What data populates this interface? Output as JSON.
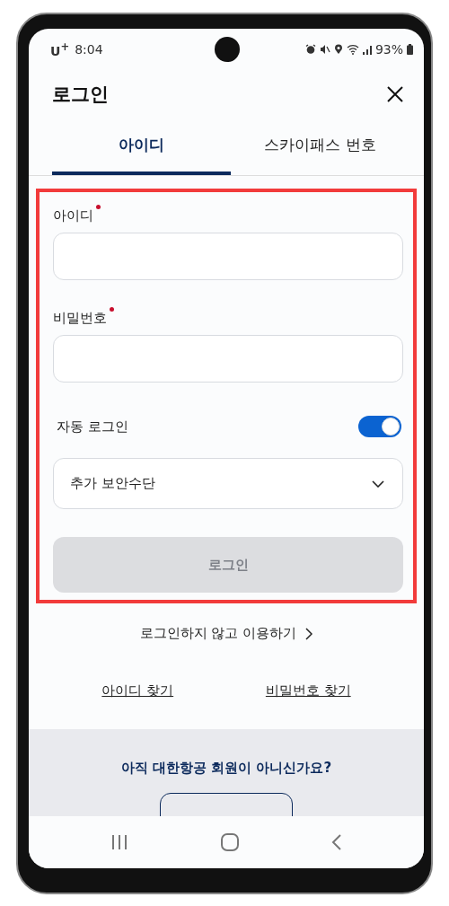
{
  "status_bar": {
    "carrier": "U$^{+}$",
    "time": "8:04",
    "battery": "93%"
  },
  "header": {
    "title": "로그인"
  },
  "tabs": [
    {
      "label": "아이디",
      "selected": true
    },
    {
      "label": "스카이패스 번호",
      "selected": false
    }
  ],
  "form": {
    "fields": [
      {
        "label": "아이디",
        "required": true
      },
      {
        "label": "비밀번호",
        "required": true
      }
    ],
    "auto_login": {
      "label": "자동 로그인",
      "on": true
    },
    "security_select": {
      "value": "추가 보안수단"
    },
    "login_button": {
      "label": "로그인",
      "disabled": true
    }
  },
  "guest_link": "로그인하지 않고 이용하기",
  "find_links": [
    "아이디 찾기",
    "비밀번호 찾기"
  ],
  "signup_section": {
    "prompt": "아직 대한항공 회원이 아니신가요?"
  }
}
